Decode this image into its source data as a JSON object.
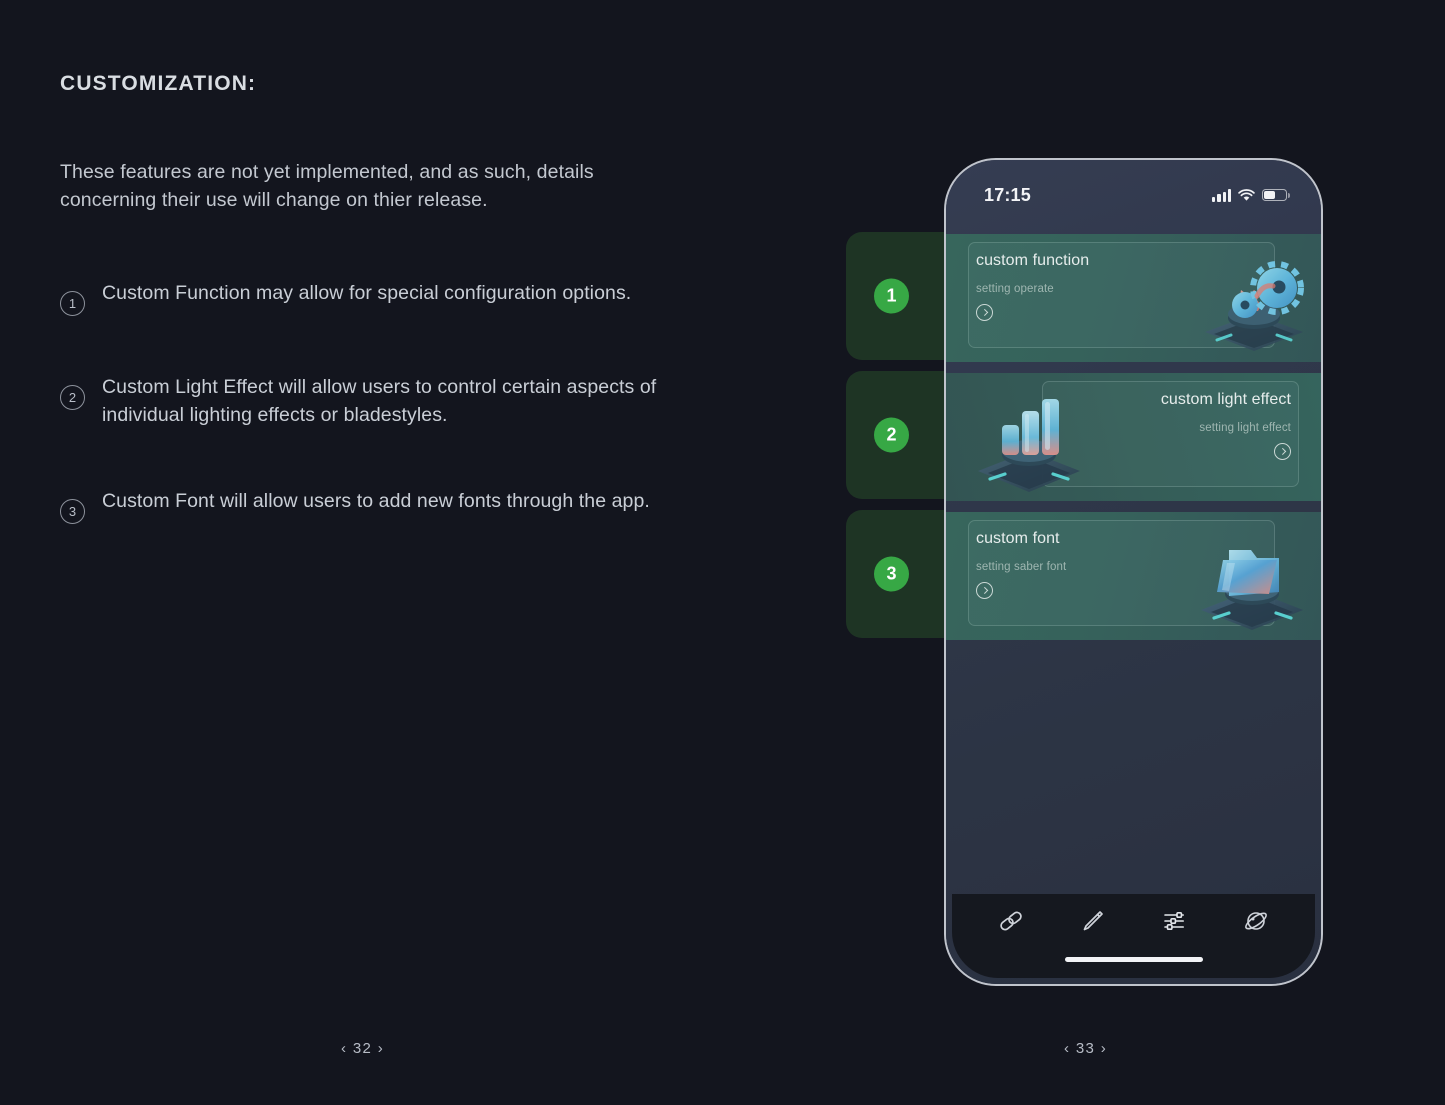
{
  "slide": {
    "title": "CUSTOMIZATION:",
    "intro": "These features are not yet implemented, and as such, details concerning their use will change on thier release.",
    "list": [
      {
        "num": "1",
        "text": "Custom Function may allow for special configuration options."
      },
      {
        "num": "2",
        "text": "Custom Light Effect will allow users to control certain aspects of individual lighting effects or bladestyles."
      },
      {
        "num": "3",
        "text": "Custom Font will allow users to add new fonts through the app."
      }
    ],
    "page_left": "‹ 32 ›",
    "page_right": "‹ 33 ›"
  },
  "phone": {
    "status": {
      "time": "17:15",
      "signal_icon": "signal-bars-icon",
      "wifi_icon": "wifi-icon",
      "battery_icon": "battery-icon"
    },
    "cards": [
      {
        "badge": "1",
        "title": "custom function",
        "subtitle": "setting operate",
        "chevron_icon": "chevron-right-circle-icon",
        "art_icon": "gear-3d-icon",
        "align": "left"
      },
      {
        "badge": "2",
        "title": "custom light effect",
        "subtitle": "setting light effect",
        "chevron_icon": "chevron-right-circle-icon",
        "art_icon": "bars-3d-icon",
        "align": "right"
      },
      {
        "badge": "3",
        "title": "custom font",
        "subtitle": "setting saber font",
        "chevron_icon": "chevron-right-circle-icon",
        "art_icon": "folder-3d-icon",
        "align": "left"
      }
    ],
    "nav": [
      {
        "icon": "link-chain-icon",
        "active": false
      },
      {
        "icon": "blade-pen-icon",
        "active": false
      },
      {
        "icon": "sliders-icon",
        "active": true
      },
      {
        "icon": "planet-icon",
        "active": false
      }
    ],
    "home_indicator": "home-indicator"
  },
  "colors": {
    "background": "#13151e",
    "badge_green": "#37a845",
    "panel_green": "#1e3424",
    "card_teal": "#2d5a53",
    "text_primary": "#c9ced6",
    "phone_frame": "#c0c4cc"
  }
}
